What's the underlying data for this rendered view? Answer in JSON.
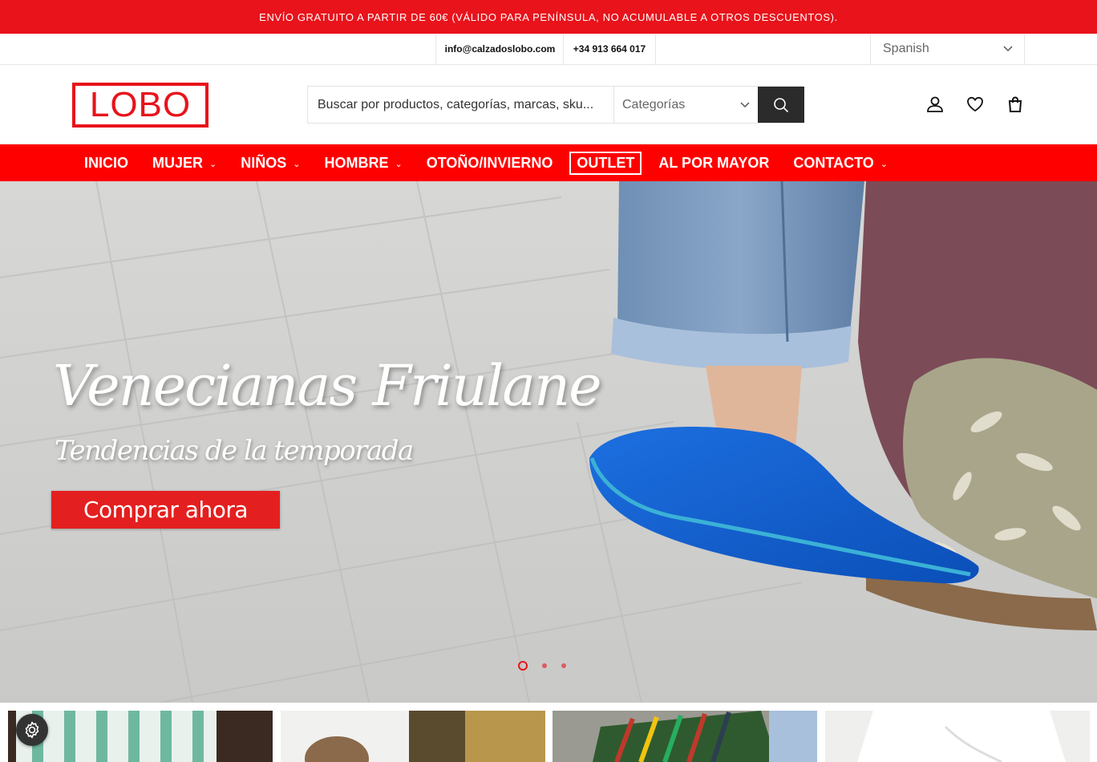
{
  "promo": {
    "text": "ENVÍO GRATUITO A PARTIR DE 60€ (VÁLIDO PARA PENÍNSULA, NO ACUMULABLE A OTROS DESCUENTOS)."
  },
  "contact": {
    "email": "info@calzadoslobo.com",
    "phone": "+34 913 664 017"
  },
  "language": {
    "selected": "Spanish"
  },
  "header": {
    "logo_text": "LOBO",
    "search_placeholder": "Buscar por productos, categorías, marcas, sku...",
    "categories_label": "Categorías"
  },
  "nav": {
    "items": [
      {
        "label": "INICIO",
        "dropdown": false
      },
      {
        "label": "MUJER",
        "dropdown": true
      },
      {
        "label": "NIÑOS",
        "dropdown": true
      },
      {
        "label": "HOMBRE",
        "dropdown": true
      },
      {
        "label": "OTOÑO/INVIERNO",
        "dropdown": false
      },
      {
        "label": "OUTLET",
        "dropdown": false
      },
      {
        "label": "AL POR MAYOR",
        "dropdown": false
      },
      {
        "label": "CONTACTO",
        "dropdown": true
      }
    ]
  },
  "hero": {
    "title": "Venecianas Friulane",
    "subtitle": "Tendencias de la temporada",
    "cta": "Comprar ahora",
    "slides": 3,
    "active_slide": 1
  },
  "colors": {
    "brand_red": "#e8131b",
    "nav_red": "#ff0000",
    "dark": "#2b2b2b"
  },
  "icons": [
    "chevron-down-icon",
    "search-icon",
    "user-icon",
    "heart-icon",
    "shopping-bag-icon",
    "gear-icon"
  ]
}
